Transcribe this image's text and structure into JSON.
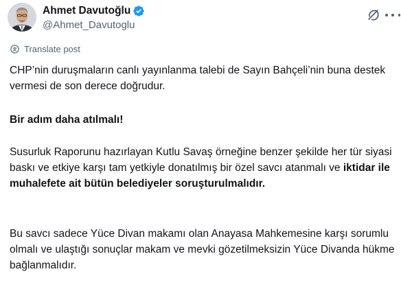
{
  "author": {
    "display_name": "Ahmet Davutoğlu",
    "handle": "@Ahmet_Davutoglu",
    "verified_color": "#1d9bf0"
  },
  "icons": {
    "avatar": "profile-photo",
    "verified": "verified-badge-icon",
    "grok": "grok-icon",
    "more": "more-options-icon",
    "translate": "translate-icon"
  },
  "translate_label": "Translate post",
  "post": {
    "p1": "CHP’nin duruşmaların canlı yayınlanma talebi de Sayın Bahçeli’nin buna destek vermesi de son derece doğrudur.",
    "p2": "Bir adım daha atılmalı!",
    "p3_a": "Susurluk Raporunu hazırlayan Kutlu Savaş örneğine benzer şekilde her tür siyasi baskı ve etkiye karşı tam yetkiyle donatılmış bir özel savcı atanmalı ve ",
    "p3_b": "iktidar ile muhalefete ait bütün belediyeler soruşturulmalıdır.",
    "p4": "Bu savcı sadece Yüce Divan makamı olan Anayasa Mahkemesine karşı sorumlu olmalı ve ulaştığı sonuçlar makam ve mevki gözetilmeksizin Yüce Divanda hükme bağlanmalıdır."
  },
  "colors": {
    "text": "#0f1419",
    "secondary": "#536471",
    "accent": "#1d9bf0"
  }
}
